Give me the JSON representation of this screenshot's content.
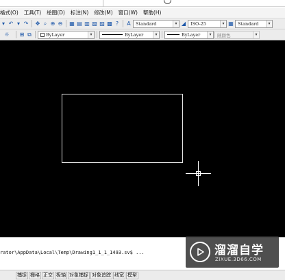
{
  "menubar": {
    "items": [
      "格式(O)",
      "工具(T)",
      "绘图(D)",
      "标注(N)",
      "修改(M)",
      "窗口(W)",
      "帮助(H)"
    ]
  },
  "toolbar1": {
    "text_style": "Standard",
    "dim_style": "ISO-25",
    "table_style": "Standard"
  },
  "toolbar2": {
    "layer_combo": "ByLayer",
    "linetype": "ByLayer",
    "lineweight": "ByLayer",
    "plot_style": "随颜色"
  },
  "command": {
    "text": "rator\\AppData\\Local\\Temp\\Drawing1_1_1_1493.sv$ ..."
  },
  "watermark": {
    "title": "溜溜自学",
    "url": "ZIXUE.3D66.COM"
  },
  "statusbar": {
    "items": [
      "捕捉",
      "栅格",
      "正交",
      "极轴",
      "对象捕捉",
      "对象追踪",
      "线宽",
      "模型"
    ]
  },
  "colors": {
    "canvas": "#000000",
    "drawing_line": "#e6e6e6",
    "crosshair": "#ffffff"
  }
}
